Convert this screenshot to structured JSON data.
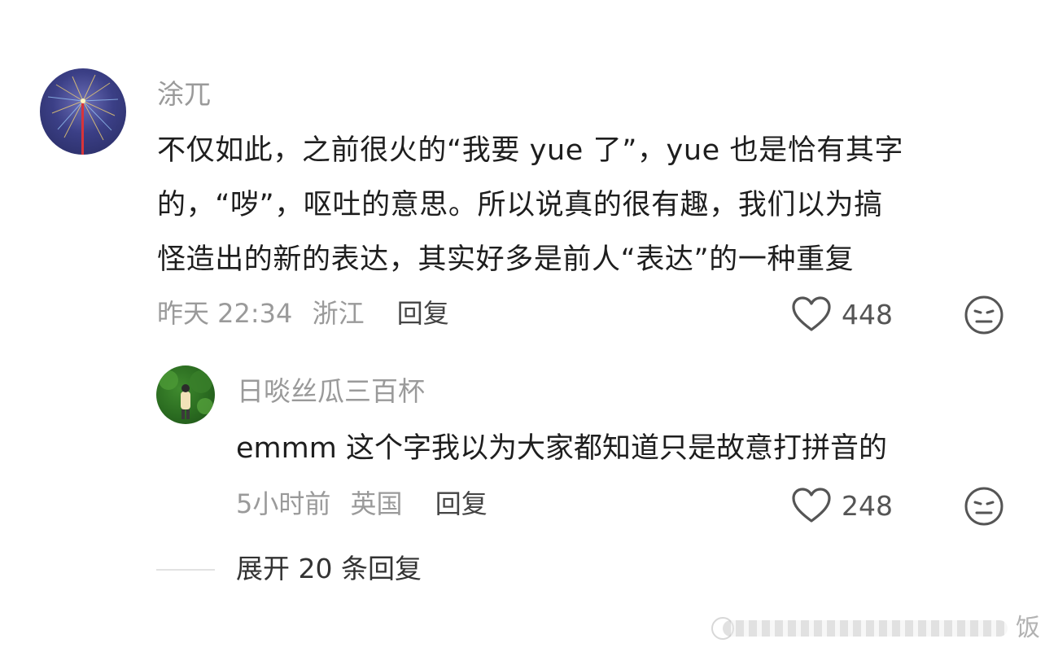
{
  "comment": {
    "username": "涂兀",
    "lines": [
      "不仅如此，之前很火的“我要 yue 了”，yue 也是恰有其字",
      "的，“哕”，呕吐的意思。所以说真的很有趣，我们以为搞",
      "怪造出的新的表达，其实好多是前人“表达”的一种重复"
    ],
    "time": "昨天 22:34",
    "location": "浙江",
    "reply_label": "回复",
    "likes": "448"
  },
  "reply": {
    "username": "日啖丝瓜三百杯",
    "text": "emmm 这个字我以为大家都知道只是故意打拼音的",
    "time": "5小时前",
    "location": "英国",
    "reply_label": "回复",
    "likes": "248"
  },
  "expand": {
    "label": "展开 20 条回复"
  },
  "watermark": {
    "char": "饭"
  }
}
